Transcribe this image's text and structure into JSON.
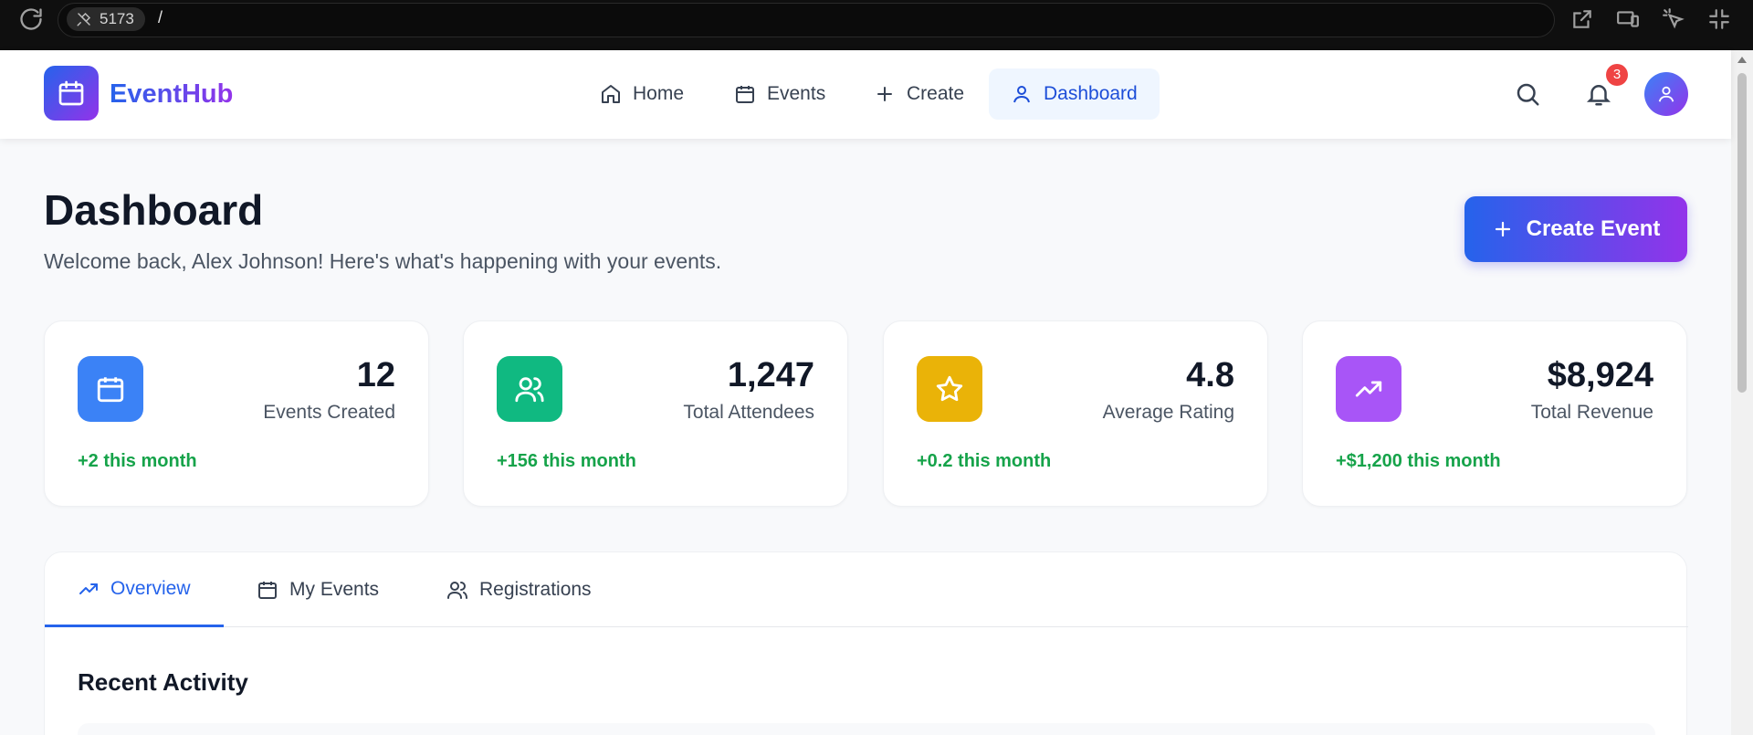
{
  "browser": {
    "port": "5173",
    "path": "/"
  },
  "brand": {
    "name": "EventHub"
  },
  "nav": {
    "items": [
      {
        "label": "Home",
        "icon": "home-icon",
        "active": false
      },
      {
        "label": "Events",
        "icon": "calendar-icon",
        "active": false
      },
      {
        "label": "Create",
        "icon": "plus-icon",
        "active": false
      },
      {
        "label": "Dashboard",
        "icon": "user-icon",
        "active": true
      }
    ],
    "notification_count": "3"
  },
  "header": {
    "title": "Dashboard",
    "subtitle": "Welcome back, Alex Johnson! Here's what's happening with your events.",
    "create_button": "Create Event"
  },
  "stats": [
    {
      "value": "12",
      "label": "Events Created",
      "change": "+2 this month",
      "icon": "calendar-icon",
      "color": "#3b82f6"
    },
    {
      "value": "1,247",
      "label": "Total Attendees",
      "change": "+156 this month",
      "icon": "users-icon",
      "color": "#10b981"
    },
    {
      "value": "4.8",
      "label": "Average Rating",
      "change": "+0.2 this month",
      "icon": "star-icon",
      "color": "#eab308"
    },
    {
      "value": "$8,924",
      "label": "Total Revenue",
      "change": "+$1,200 this month",
      "icon": "trending-up-icon",
      "color": "#a855f7"
    }
  ],
  "tabs": [
    {
      "label": "Overview",
      "icon": "trending-up-icon",
      "active": true
    },
    {
      "label": "My Events",
      "icon": "calendar-icon",
      "active": false
    },
    {
      "label": "Registrations",
      "icon": "users-icon",
      "active": false
    }
  ],
  "section": {
    "title": "Recent Activity"
  },
  "colors": {
    "accent": "#2563eb",
    "brand_gradient_end": "#9333ea",
    "positive": "#16a34a",
    "badge": "#ef4444"
  }
}
